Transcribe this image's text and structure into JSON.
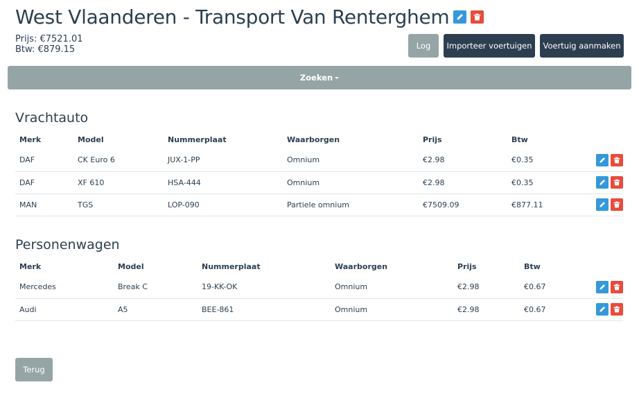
{
  "header": {
    "title": "West Vlaanderen - Transport Van Renterghem",
    "price": "Prijs: €7521.01",
    "vat": "Btw: €879.15"
  },
  "actions": {
    "log": "Log",
    "import": "Importeer voertuigen",
    "create": "Voertuig aanmaken"
  },
  "search": {
    "label": "Zoeken"
  },
  "columns": {
    "brand": "Merk",
    "model": "Model",
    "plate": "Nummerplaat",
    "guarantee": "Waarborgen",
    "price": "Prijs",
    "vat": "Btw"
  },
  "sections": [
    {
      "title": "Vrachtauto",
      "rows": [
        {
          "brand": "DAF",
          "model": "CK Euro 6",
          "plate": "JUX-1-PP",
          "guarantee": "Omnium",
          "price": "€2.98",
          "vat": "€0.35"
        },
        {
          "brand": "DAF",
          "model": "XF 610",
          "plate": "HSA-444",
          "guarantee": "Omnium",
          "price": "€2.98",
          "vat": "€0.35"
        },
        {
          "brand": "MAN",
          "model": "TGS",
          "plate": "LOP-090",
          "guarantee": "Partiele omnium",
          "price": "€7509.09",
          "vat": "€877.11"
        }
      ]
    },
    {
      "title": "Personenwagen",
      "rows": [
        {
          "brand": "Mercedes",
          "model": "Break C",
          "plate": "19-KK-OK",
          "guarantee": "Omnium",
          "price": "€2.98",
          "vat": "€0.67"
        },
        {
          "brand": "Audi",
          "model": "A5",
          "plate": "BEE-861",
          "guarantee": "Omnium",
          "price": "€2.98",
          "vat": "€0.67"
        }
      ]
    }
  ],
  "footer": {
    "back": "Terug"
  },
  "colors": {
    "primary": "#2c3e50",
    "muted": "#95a5a6",
    "edit": "#3498db",
    "delete": "#e74c3c"
  },
  "icons": {
    "edit": "pencil-icon",
    "delete": "trash-icon"
  }
}
